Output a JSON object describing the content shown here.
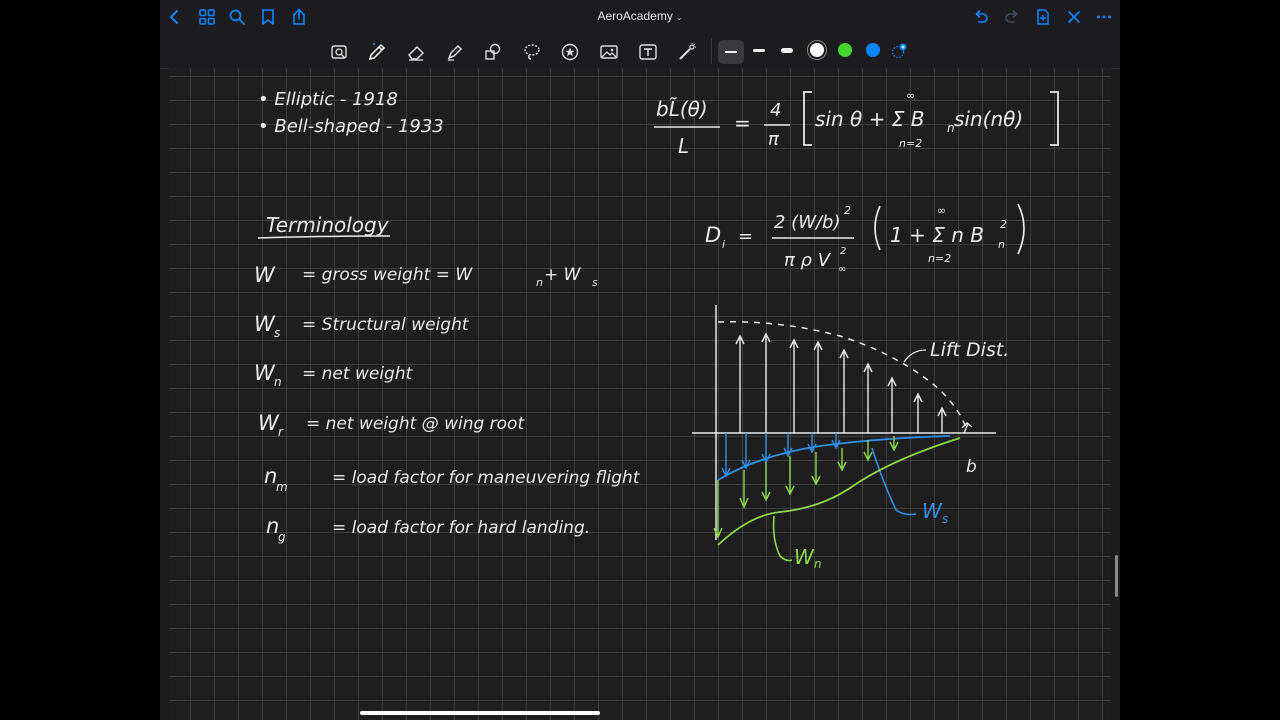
{
  "app": {
    "title": "AeroAcademy"
  },
  "nav": {
    "back_icon": "chevron-left-icon",
    "grid_icon": "grid-icon",
    "search_icon": "search-icon",
    "bookmark_icon": "bookmark-icon",
    "share_icon": "share-icon",
    "undo_icon": "undo-icon",
    "redo_icon": "redo-icon",
    "add_page_icon": "add-page-icon",
    "close_icon": "close-icon",
    "more_icon": "more-icon"
  },
  "colors": {
    "accent": "#0a84ff",
    "green": "#44d62c",
    "blue": "#0a84ff",
    "white": "#ffffff",
    "ink_blue": "#2f8fe8",
    "ink_green": "#8ed94a"
  },
  "notes": {
    "intro": [
      "• Elliptic      - 1918",
      "• Bell-shaped      - 1933"
    ],
    "terminology_title": "Terminology",
    "definitions": [
      {
        "sym": "W",
        "sub": "",
        "text": "=   gross weight   =  W",
        "extra_sub": "n",
        "tail": " + W",
        "tail_sub": "s"
      },
      {
        "sym": "W",
        "sub": "s",
        "text": "=  Structural weight"
      },
      {
        "sym": "W",
        "sub": "n",
        "text": "=  net weight"
      },
      {
        "sym": "W",
        "sub": "r",
        "text": "=  net weight @ wing root"
      },
      {
        "sym": "n",
        "sub": "m",
        "text": "=  load factor  for  maneuvering  flight"
      },
      {
        "sym": "n",
        "sub": "g",
        "text": "=  load factor  for  hard landing."
      }
    ],
    "eq1": {
      "lhs_num": "bL̃(θ)",
      "lhs_den": "L",
      "coef_num": "4",
      "coef_den": "π",
      "body": "sin θ  +  Σ  B",
      "body_sub": "n",
      "body_tail": " sin(nθ)",
      "sum_top": "∞",
      "sum_bot": "n=2"
    },
    "eq2": {
      "lhs": "D",
      "lhs_sub": "i",
      "num": "2 (W/b)",
      "num_sup": "2",
      "den": "π ρ V",
      "den_sub": "∞",
      "den_sup": "2",
      "body": "1 +  Σ  n B",
      "body_sub": "n",
      "body_sup": "2",
      "sum_top": "∞",
      "sum_bot": "n=2"
    },
    "diagram": {
      "lift_label": "Lift Dist.",
      "ws_label": "W",
      "ws_sub": "s",
      "wn_label": "W",
      "wn_sub": "n",
      "b_label": "b"
    }
  }
}
